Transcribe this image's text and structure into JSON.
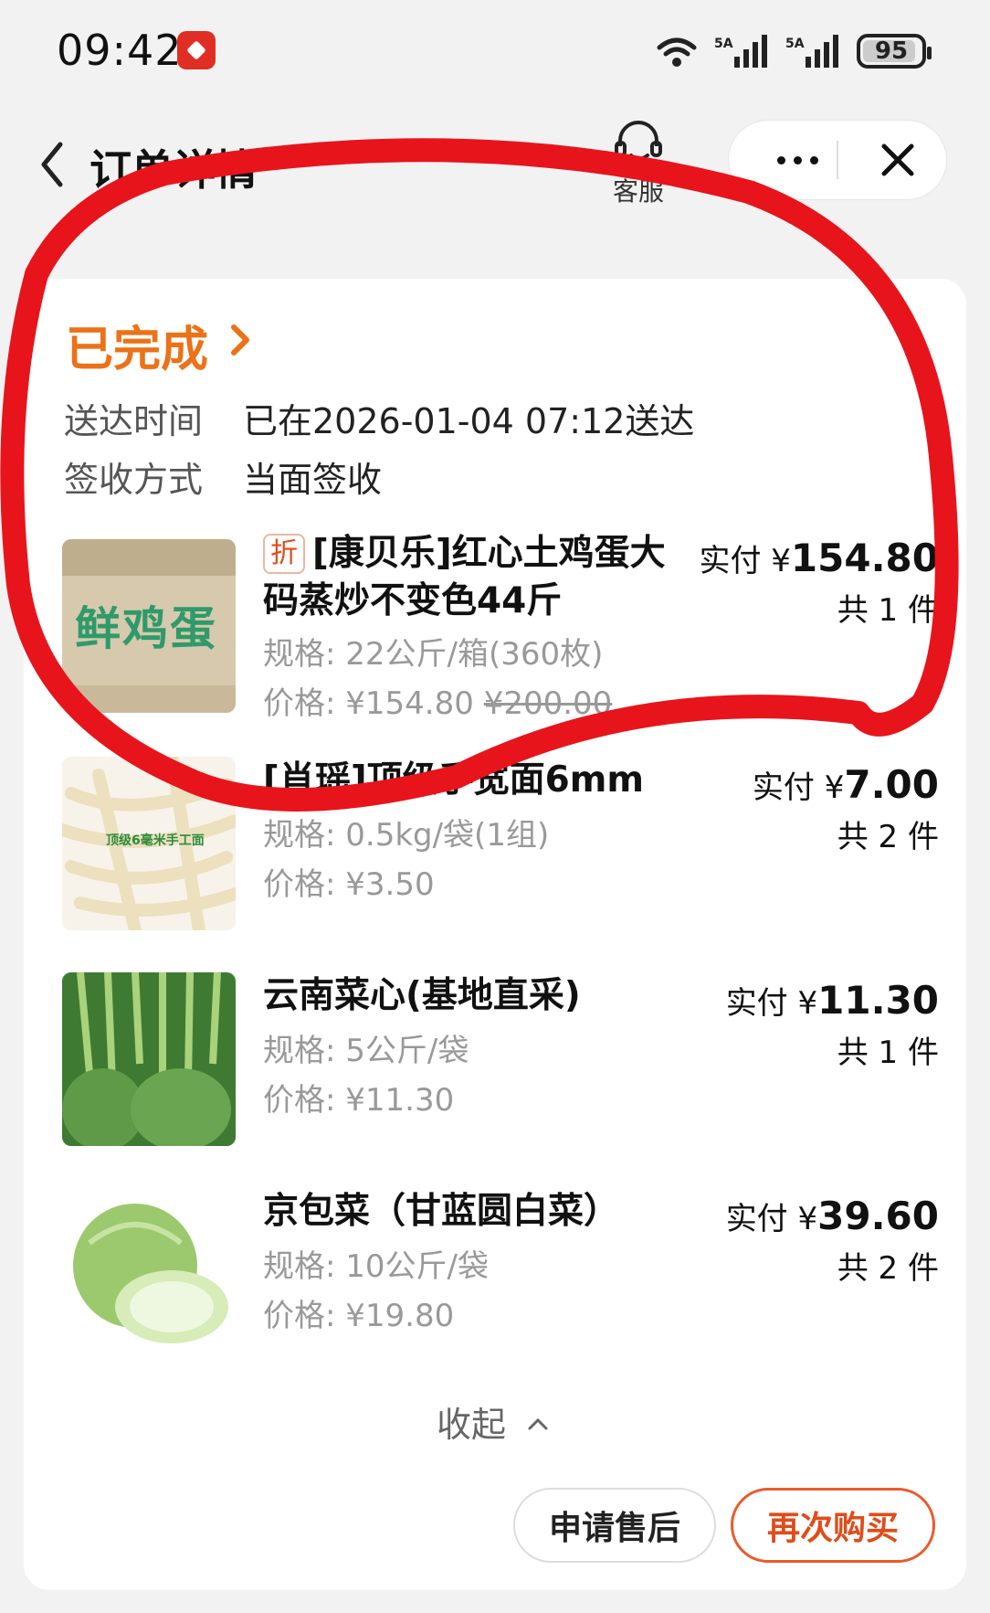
{
  "status_bar": {
    "time": "09:42",
    "battery": "95",
    "signal1": "5A",
    "signal2": "5A",
    "wifi": "6"
  },
  "nav": {
    "title": "订单详情",
    "service_label": "客服"
  },
  "order": {
    "status": "已完成",
    "delivery_label": "送达时间",
    "delivery_value": "已在2026-01-04 07:12送达",
    "sign_label": "签收方式",
    "sign_value": "当面签收"
  },
  "items": [
    {
      "discount_tag": "折",
      "name": "[康贝乐]红心土鸡蛋大码蒸炒不变色44斤",
      "spec": "规格: 22公斤/箱(360枚)",
      "price": "价格: ¥154.80",
      "original_price": "¥200.00",
      "paid_label": "实付 ¥",
      "paid_amount": "154.80",
      "qty": "共 1 件",
      "image_text": "鲜鸡蛋"
    },
    {
      "name": "[肖瑶]顶级手宽面6mm",
      "spec": "规格: 0.5kg/袋(1组)",
      "price": "价格: ¥3.50",
      "paid_label": "实付 ¥",
      "paid_amount": "7.00",
      "qty": "共 2 件",
      "image_text": "顶级6毫米手工面"
    },
    {
      "name": "云南菜心(基地直采)",
      "spec": "规格: 5公斤/袋",
      "price": "价格: ¥11.30",
      "paid_label": "实付 ¥",
      "paid_amount": "11.30",
      "qty": "共 1 件"
    },
    {
      "name": "京包菜（甘蓝圆白菜）",
      "spec": "规格: 10公斤/袋",
      "price": "价格: ¥19.80",
      "paid_label": "实付 ¥",
      "paid_amount": "39.60",
      "qty": "共 2 件"
    }
  ],
  "collapse_label": "收起",
  "buttons": {
    "after_sale": "申请售后",
    "buy_again": "再次购买"
  },
  "colors": {
    "accent": "#ec7117",
    "discount": "#e04c1a",
    "annotation": "#e8141b"
  }
}
